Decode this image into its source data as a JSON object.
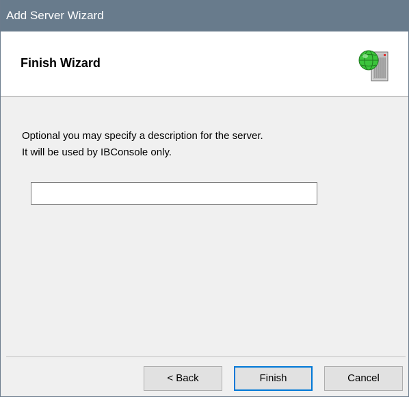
{
  "window": {
    "title": "Add Server Wizard"
  },
  "header": {
    "title": "Finish Wizard",
    "icon": "server-globe-icon"
  },
  "body": {
    "line1": "Optional you may specify a description for the server.",
    "line2": "It will be used by IBConsole only.",
    "description_value": "",
    "description_placeholder": ""
  },
  "buttons": {
    "back": "< Back",
    "finish": "Finish",
    "cancel": "Cancel"
  },
  "colors": {
    "titlebar": "#687b8c",
    "default_button_border": "#0078d7"
  }
}
